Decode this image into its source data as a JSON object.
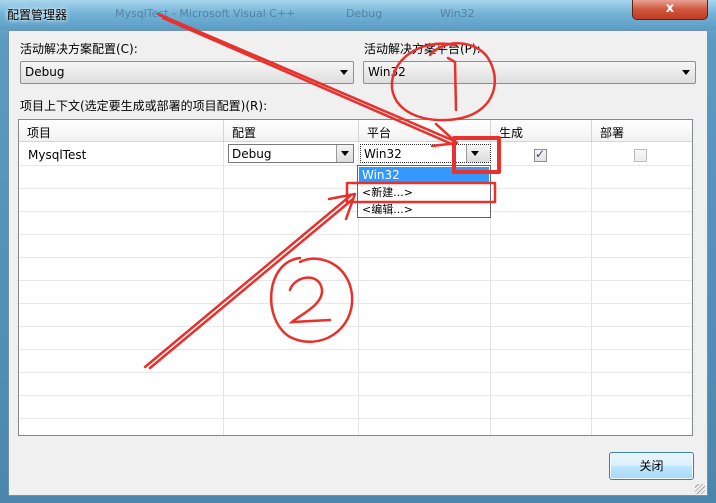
{
  "window": {
    "title": "配置管理器",
    "close_glyph": "x",
    "background_ghost": [
      "MysqlTest - Microsoft Visual C++",
      "Debug",
      "Win32"
    ]
  },
  "solution": {
    "config_label": "活动解决方案配置(C):",
    "config_value": "Debug",
    "platform_label": "活动解决方案平台(P):",
    "platform_value": "Win32"
  },
  "context_label": "项目上下文(选定要生成或部署的项目配置)(R):",
  "grid": {
    "headers": [
      "项目",
      "配置",
      "平台",
      "生成",
      "部署"
    ],
    "rows": [
      {
        "project": "MysqlTest",
        "configuration": "Debug",
        "platform": "Win32",
        "build": true,
        "deploy": false
      }
    ]
  },
  "platform_dropdown": {
    "options": [
      "Win32",
      "<新建...>",
      "<编辑...>"
    ],
    "selected": "Win32"
  },
  "annotations": {
    "marker_1": "1",
    "marker_2": "2",
    "color": "#e8302c"
  },
  "buttons": {
    "close": "关闭"
  },
  "colors": {
    "selection": "#3399ff",
    "annotation": "#e8302c"
  }
}
